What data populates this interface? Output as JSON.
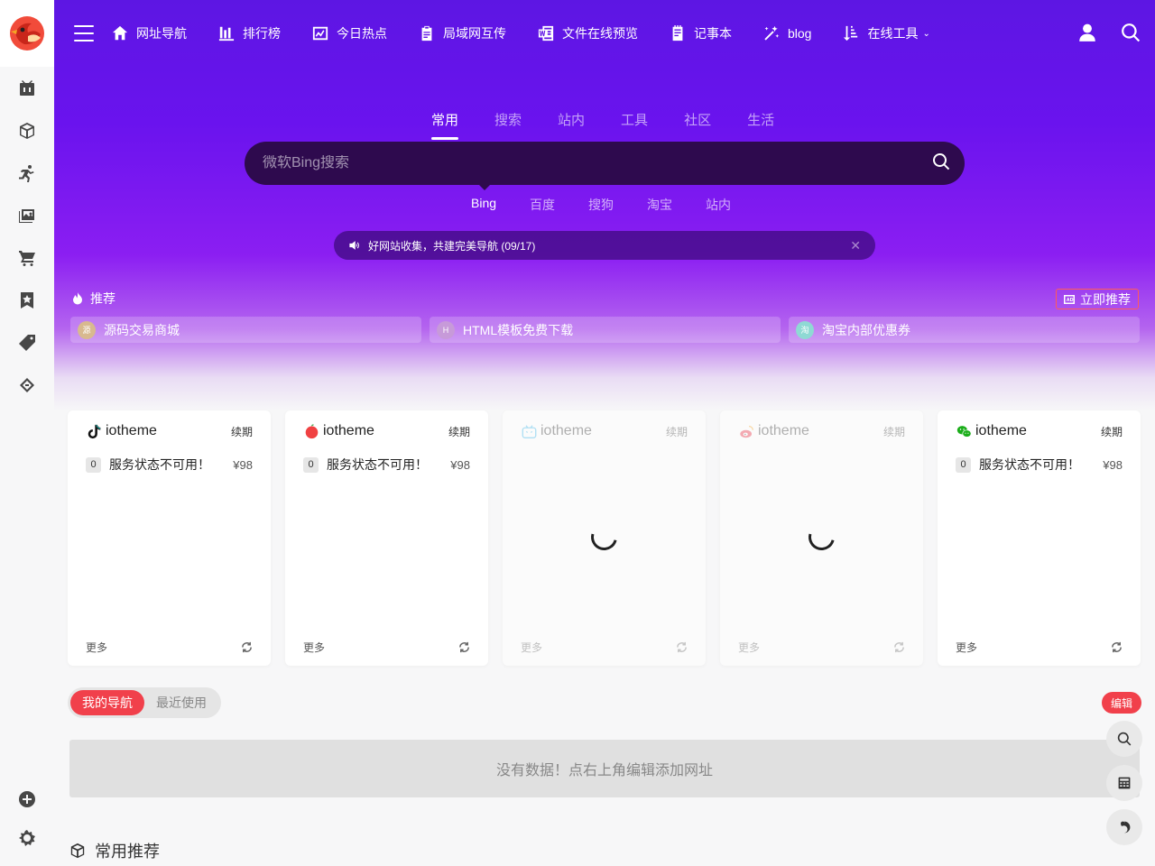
{
  "sidebar": {
    "items": [
      {
        "icon": "tv-icon"
      },
      {
        "icon": "cube-icon"
      },
      {
        "icon": "runner-icon"
      },
      {
        "icon": "image-icon"
      },
      {
        "icon": "cart-icon"
      },
      {
        "icon": "bookmark-star-icon"
      },
      {
        "icon": "tag-icon"
      },
      {
        "icon": "handshake-icon"
      }
    ],
    "bottom": [
      {
        "icon": "add-circle-icon"
      },
      {
        "icon": "settings-icon"
      }
    ]
  },
  "nav": {
    "items": [
      {
        "label": "网址导航",
        "icon": "home-icon"
      },
      {
        "label": "排行榜",
        "icon": "bar-chart-icon"
      },
      {
        "label": "今日热点",
        "icon": "trend-icon"
      },
      {
        "label": "局域网互传",
        "icon": "clipboard-icon"
      },
      {
        "label": "文件在线预览",
        "icon": "word-icon"
      },
      {
        "label": "记事本",
        "icon": "notepad-icon"
      },
      {
        "label": "blog",
        "icon": "wand-icon"
      },
      {
        "label": "在线工具",
        "icon": "sort-icon"
      }
    ],
    "right": [
      "user-icon",
      "search-icon"
    ]
  },
  "search": {
    "tabs": [
      "常用",
      "搜索",
      "站内",
      "工具",
      "社区",
      "生活"
    ],
    "active_tab": "常用",
    "placeholder": "微软Bing搜索",
    "engines": [
      "Bing",
      "百度",
      "搜狗",
      "淘宝",
      "站内"
    ],
    "active_engine": "Bing"
  },
  "notice": {
    "text": "好网站收集，共建完美导航 (09/17)",
    "close": "✕"
  },
  "recommend": {
    "label": "推荐",
    "button": "立即推荐",
    "items": [
      {
        "label": "源码交易商城",
        "badge": "源",
        "color": "#d8b98f"
      },
      {
        "label": "HTML模板免费下载",
        "badge": "H",
        "color": "#c79ad9"
      },
      {
        "label": "淘宝内部优惠券",
        "badge": "淘",
        "color": "#8fd9d4"
      }
    ]
  },
  "cards": [
    {
      "title": "iotheme",
      "renew": "续期",
      "index": "0",
      "status": "服务状态不可用！",
      "price": "¥98",
      "more": "更多",
      "loading": false,
      "icon": "tiktok-icon"
    },
    {
      "title": "iotheme",
      "renew": "续期",
      "index": "0",
      "status": "服务状态不可用！",
      "price": "¥98",
      "more": "更多",
      "loading": false,
      "icon": "toutiao-icon"
    },
    {
      "title": "iotheme",
      "renew": "续期",
      "more": "更多",
      "loading": true,
      "icon": "bilibili-icon"
    },
    {
      "title": "iotheme",
      "renew": "续期",
      "more": "更多",
      "loading": true,
      "icon": "weibo-icon"
    },
    {
      "title": "iotheme",
      "renew": "续期",
      "index": "0",
      "status": "服务状态不可用！",
      "price": "¥98",
      "more": "更多",
      "loading": false,
      "icon": "wechat-icon"
    }
  ],
  "mynav": {
    "tabs": [
      "我的导航",
      "最近使用"
    ],
    "active_tab": "我的导航",
    "edit": "编辑",
    "empty": "没有数据！点右上角编辑添加网址"
  },
  "section": {
    "title": "常用推荐",
    "icon": "cube-icon"
  },
  "float": [
    "search-icon",
    "calculator-icon",
    "theme-icon"
  ],
  "colors": {
    "accent": "#f1404b",
    "hero_top": "#5d16e3",
    "hero_mid": "#8b1ef2"
  }
}
